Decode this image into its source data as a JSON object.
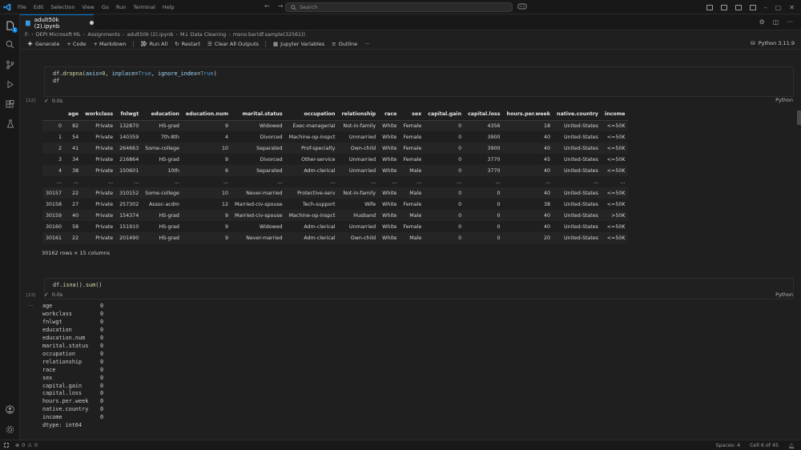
{
  "titlebar": {
    "menu": [
      "File",
      "Edit",
      "Selection",
      "View",
      "Go",
      "Run",
      "Terminal",
      "Help"
    ],
    "search_placeholder": "Search"
  },
  "activity": {
    "explorer_badge": "1"
  },
  "tab": {
    "title": "adult50k (2).ipynb"
  },
  "breadcrumb": [
    "F:",
    "DEPI Microsoft ML",
    "Assignments",
    "adult50k (2).ipynb",
    "M↓ Data Cleaning",
    "msno.bar(df.sample(32561))"
  ],
  "toolbar": {
    "generate": "Generate",
    "code": "+ Code",
    "markdown": "+ Markdown",
    "run_all": "Run All",
    "restart": "Restart",
    "clear_outputs": "Clear All Outputs",
    "variables": "Jupyter Variables",
    "outline": "Outline",
    "more": "···",
    "kernel": "Python 3.11.9"
  },
  "cell1": {
    "line1": {
      "obj": "df.",
      "fn": "dropna",
      "open": "(",
      "p1": "axis",
      "eq1": "=",
      "v1": "0",
      "c1": ", ",
      "p2": "inplace",
      "eq2": "=",
      "v2": "True",
      "c2": ", ",
      "p3": "ignore_index",
      "eq3": "=",
      "v3": "True",
      "close": ")"
    },
    "line2": "df",
    "exec_count": "[12]",
    "time": "0.0s",
    "language": "Python"
  },
  "dataframe": {
    "columns": [
      "",
      "age",
      "workclass",
      "fnlwgt",
      "education",
      "education.num",
      "marital.status",
      "occupation",
      "relationship",
      "race",
      "sex",
      "capital.gain",
      "capital.loss",
      "hours.per.week",
      "native.country",
      "income"
    ],
    "rows": [
      [
        "0",
        "82",
        "Private",
        "132870",
        "HS-grad",
        "9",
        "Widowed",
        "Exec-managerial",
        "Not-in-family",
        "White",
        "Female",
        "0",
        "4356",
        "18",
        "United-States",
        "<=50K"
      ],
      [
        "1",
        "54",
        "Private",
        "140359",
        "7th-8th",
        "4",
        "Divorced",
        "Machine-op-inspct",
        "Unmarried",
        "White",
        "Female",
        "0",
        "3900",
        "40",
        "United-States",
        "<=50K"
      ],
      [
        "2",
        "41",
        "Private",
        "264663",
        "Some-college",
        "10",
        "Separated",
        "Prof-specialty",
        "Own-child",
        "White",
        "Female",
        "0",
        "3900",
        "40",
        "United-States",
        "<=50K"
      ],
      [
        "3",
        "34",
        "Private",
        "216864",
        "HS-grad",
        "9",
        "Divorced",
        "Other-service",
        "Unmarried",
        "White",
        "Female",
        "0",
        "3770",
        "45",
        "United-States",
        "<=50K"
      ],
      [
        "4",
        "38",
        "Private",
        "150601",
        "10th",
        "6",
        "Separated",
        "Adm-clerical",
        "Unmarried",
        "White",
        "Male",
        "0",
        "3770",
        "40",
        "United-States",
        "<=50K"
      ],
      [
        "...",
        "...",
        "...",
        "...",
        "...",
        "...",
        "...",
        "...",
        "...",
        "...",
        "...",
        "...",
        "...",
        "...",
        "...",
        "..."
      ],
      [
        "30157",
        "22",
        "Private",
        "310152",
        "Some-college",
        "10",
        "Never-married",
        "Protective-serv",
        "Not-in-family",
        "White",
        "Male",
        "0",
        "0",
        "40",
        "United-States",
        "<=50K"
      ],
      [
        "30158",
        "27",
        "Private",
        "257302",
        "Assoc-acdm",
        "12",
        "Married-civ-spouse",
        "Tech-support",
        "Wife",
        "White",
        "Female",
        "0",
        "0",
        "38",
        "United-States",
        "<=50K"
      ],
      [
        "30159",
        "40",
        "Private",
        "154374",
        "HS-grad",
        "9",
        "Married-civ-spouse",
        "Machine-op-inspct",
        "Husband",
        "White",
        "Male",
        "0",
        "0",
        "40",
        "United-States",
        ">50K"
      ],
      [
        "30160",
        "58",
        "Private",
        "151910",
        "HS-grad",
        "9",
        "Widowed",
        "Adm-clerical",
        "Unmarried",
        "White",
        "Female",
        "0",
        "0",
        "40",
        "United-States",
        "<=50K"
      ],
      [
        "30161",
        "22",
        "Private",
        "201490",
        "HS-grad",
        "9",
        "Never-married",
        "Adm-clerical",
        "Own-child",
        "White",
        "Male",
        "0",
        "0",
        "20",
        "United-States",
        "<=50K"
      ]
    ],
    "shape": "30162 rows × 15 columns"
  },
  "cell2": {
    "code": {
      "obj": "df.",
      "fn1": "isna",
      "p1": "().",
      "fn2": "sum",
      "p2": "()"
    },
    "exec_count": "[13]",
    "time": "0.0s",
    "language": "Python",
    "output_gutter": "···",
    "series": [
      [
        "age",
        "0"
      ],
      [
        "workclass",
        "0"
      ],
      [
        "fnlwgt",
        "0"
      ],
      [
        "education",
        "0"
      ],
      [
        "education.num",
        "0"
      ],
      [
        "marital.status",
        "0"
      ],
      [
        "occupation",
        "0"
      ],
      [
        "relationship",
        "0"
      ],
      [
        "race",
        "0"
      ],
      [
        "sex",
        "0"
      ],
      [
        "capital.gain",
        "0"
      ],
      [
        "capital.loss",
        "0"
      ],
      [
        "hours.per.week",
        "0"
      ],
      [
        "native.country",
        "0"
      ],
      [
        "income",
        "0"
      ]
    ],
    "dtype": "dtype: int64"
  },
  "status": {
    "errors": "0",
    "warnings": "0",
    "spaces": "Spaces: 4",
    "cell": "Cell 6 of 45"
  },
  "colors": {
    "accent": "#0078d4",
    "success": "#89d185",
    "background": "#1f1f1f"
  }
}
